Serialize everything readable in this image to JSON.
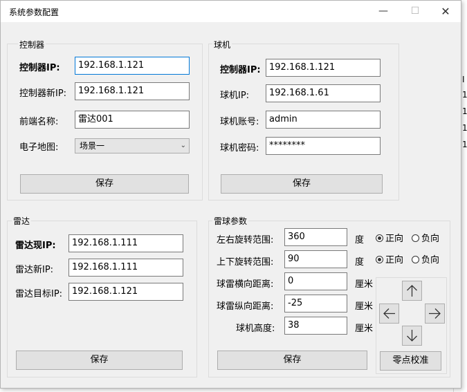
{
  "window": {
    "title": "系统参数配置",
    "minimize": "—",
    "maximize": "☐",
    "close": "✕"
  },
  "background_rows": [
    "I",
    "1",
    "1",
    "1",
    "1"
  ],
  "controller": {
    "title": "控制器",
    "ip_label": "控制器IP:",
    "ip_value": "192.168.1.121",
    "new_ip_label": "控制器新IP:",
    "new_ip_value": "192.168.1.121",
    "frontend_name_label": "前端名称:",
    "frontend_name_value": "雷达001",
    "map_label": "电子地图:",
    "map_value": "场景一",
    "save_label": "保存"
  },
  "dome": {
    "title": "球机",
    "controller_ip_label": "控制器IP:",
    "controller_ip_value": "192.168.1.121",
    "dome_ip_label": "球机IP:",
    "dome_ip_value": "192.168.1.61",
    "account_label": "球机账号:",
    "account_value": "admin",
    "password_label": "球机密码:",
    "password_value": "********",
    "save_label": "保存"
  },
  "radar": {
    "title": "雷达",
    "current_ip_label": "雷达现IP:",
    "current_ip_value": "192.168.1.111",
    "new_ip_label": "雷达新IP:",
    "new_ip_value": "192.168.1.111",
    "target_ip_label": "雷达目标IP:",
    "target_ip_value": "192.168.1.121",
    "save_label": "保存"
  },
  "radar_dome": {
    "title": "雷球参数",
    "pan_range_label": "左右旋转范围:",
    "pan_range_value": "360",
    "pan_unit": "度",
    "tilt_range_label": "上下旋转范围:",
    "tilt_range_value": "90",
    "tilt_unit": "度",
    "h_distance_label": "球雷横向距离:",
    "h_distance_value": "0",
    "h_unit": "厘米",
    "v_distance_label": "球雷纵向距离:",
    "v_distance_value": "-25",
    "v_unit": "厘米",
    "height_label": "球机高度:",
    "height_value": "38",
    "height_unit": "厘米",
    "forward_label": "正向",
    "reverse_label": "负向",
    "pan_direction": "正向",
    "tilt_direction": "正向",
    "save_label": "保存",
    "calibrate_label": "零点校准"
  }
}
